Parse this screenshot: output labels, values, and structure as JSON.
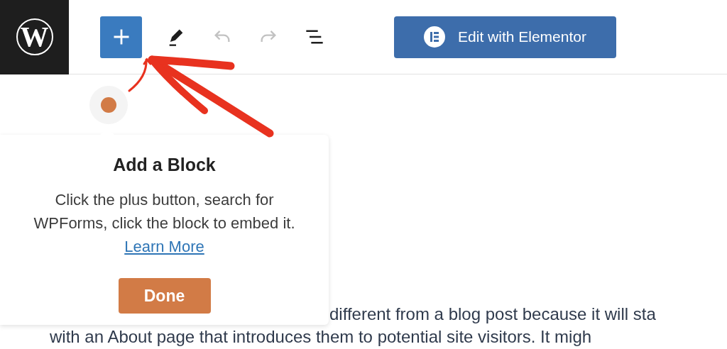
{
  "toolbar": {
    "logo_text": "W",
    "tools": [
      {
        "kind": "add",
        "disabled": false
      },
      {
        "kind": "edit",
        "disabled": false
      },
      {
        "kind": "undo",
        "disabled": true
      },
      {
        "kind": "redo",
        "disabled": true
      },
      {
        "kind": "outline",
        "disabled": false
      }
    ],
    "elementor_button": {
      "label": "Edit with Elementor"
    }
  },
  "guide": {
    "title": "Add a Block",
    "text": "Click the plus button, search for WPForms, click the block to embed it.",
    "link": "Learn More",
    "button": "Done"
  },
  "content": {
    "lines": [
      "different from a blog post because it will sta",
      "with an About page that introduces them to potential site visitors. It migh"
    ]
  }
}
